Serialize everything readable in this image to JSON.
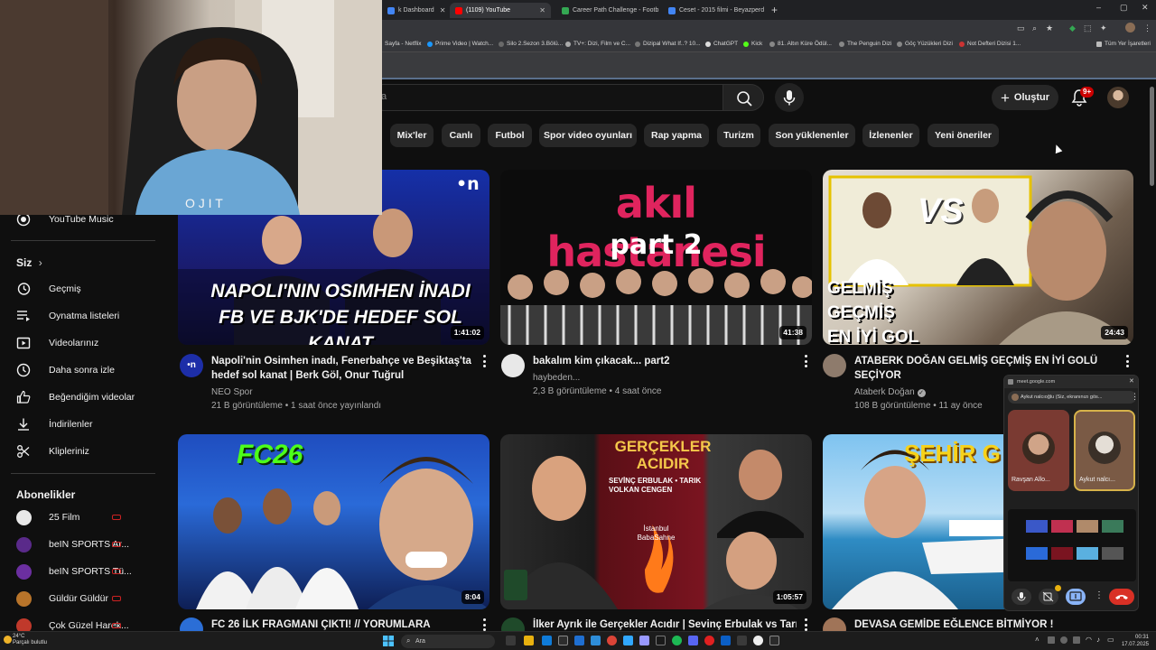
{
  "browser": {
    "tabs": [
      {
        "label": "k Dashboard",
        "color": "#4285f4"
      },
      {
        "label": "(1109) YouTube",
        "color": "#ff0000"
      },
      {
        "label": "Career Path Challenge - Footb",
        "color": "#34a853"
      },
      {
        "label": "Ceset - 2015 filmi - Beyazperd",
        "color": "#4285f4"
      }
    ],
    "window_controls": [
      "–",
      "▢",
      "✕"
    ],
    "bookmarks": [
      "Sayfa - Netflix",
      "Prime Video | Watch...",
      "Silo 2.Sezon 3.Bölü...",
      "TV+: Dizi, Film ve C...",
      "Dizipal What If..? 10...",
      "ChatGPT",
      "Kick",
      "81. Altın Küre Ödül...",
      "The Penguin Dizi",
      "Göç Yüzükleri Dizi",
      "Not Defteri Dizisi 1...",
      "Tüm Yer İşaretleri"
    ]
  },
  "header": {
    "search_placeholder": "a",
    "create_label": "Oluştur",
    "notification_count": "9+"
  },
  "chips": [
    "Mix'ler",
    "Canlı",
    "Futbol",
    "Spor video oyunları",
    "Rap yapma",
    "Turizm",
    "Son yüklenenler",
    "İzlenenler",
    "Yeni öneriler"
  ],
  "sidebar": {
    "top_item": "YouTube Music",
    "you_heading": "Siz",
    "you_items": [
      "Geçmiş",
      "Oynatma listeleri",
      "Videolarınız",
      "Daha sonra izle",
      "Beğendiğim videolar",
      "İndirilenler",
      "Klipleriniz"
    ],
    "subs_heading": "Abonelikler",
    "subscriptions": [
      "25 Film",
      "beIN SPORTS Ar...",
      "beIN SPORTS Tü...",
      "Güldür Güldür",
      "Çok Güzel Harek..."
    ]
  },
  "videos": [
    {
      "thumb_text": "NAPOLI'NIN OSIMHEN İNADI\nFB VE BJK'DE HEDEF SOL KANAT",
      "thumb_badge": "•n",
      "duration": "1:41:02",
      "title": "Napoli'nin Osimhen inadı, Fenerbahçe ve Beşiktaş'ta hedef sol kanat | Berk Göl, Onur Tuğrul",
      "channel": "NEO Spor",
      "meta": "21 B görüntüleme • 1 saat önce yayınlandı",
      "avatar_text": "•n"
    },
    {
      "thumb_text": "akıl hastanesi",
      "thumb_sub": "part 2",
      "duration": "41:38",
      "title": "bakalım kim çıkacak... part2",
      "channel": "haybeden...",
      "meta": "2,3 B görüntüleme • 4 saat önce"
    },
    {
      "thumb_vs": "VS",
      "thumb_text": "GELMİŞ GEÇMİŞ\nEN İYİ GOL",
      "duration": "24:43",
      "title": "ATABERK DOĞAN GELMİŞ GEÇMİŞ EN İYİ GOLÜ SEÇİYOR",
      "channel": "Ataberk Doğan",
      "meta": "108 B görüntüleme • 11 ay önce"
    },
    {
      "thumb_text": "FC26",
      "duration": "8:04",
      "title": "FC 26 İLK FRAGMANI ÇIKTI! // YORUMLARA"
    },
    {
      "thumb_text": "GERÇEKLER\nACIDIR",
      "thumb_sub": "SEVİNÇ ERBULAK • TARIK VOLKAN CENGEN",
      "thumb_place": "İstanbul BabaSahne",
      "duration": "1:05:57",
      "title": "İlker Ayrık ile Gerçekler Acıdır | Sevinç Erbulak vs Tarık"
    },
    {
      "thumb_text": "ŞEHİR G",
      "title": "DEVASA GEMİDE EĞLENCE BİTMİYOR !"
    }
  ],
  "meet": {
    "url": "meet.google.com",
    "header_text": "Aykut nalcıoğlu (Siz, ekranınızı gös...",
    "participants": [
      "Ravşan Allo...",
      "Aykut nalcı..."
    ]
  },
  "taskbar": {
    "weather_temp": "24°C",
    "weather_desc": "Parçalı bulutlu",
    "search_label": "Ara",
    "time": "00:31",
    "date": "17.07.2025"
  }
}
